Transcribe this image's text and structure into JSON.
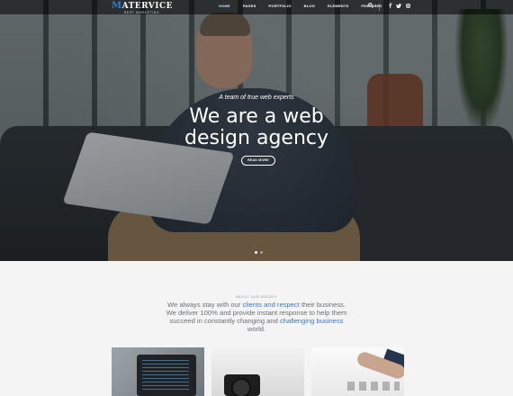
{
  "nav": {
    "logo_letter": "M",
    "logo_rest": "ATERVICE",
    "logo_sub": "BEST MARKETING",
    "items": [
      {
        "label": "HOME",
        "active": true
      },
      {
        "label": "PAGES"
      },
      {
        "label": "PORTFOLIO"
      },
      {
        "label": "BLOG"
      },
      {
        "label": "ELEMENTS"
      },
      {
        "label": "FEATURES"
      }
    ],
    "icons": [
      "search-icon",
      "facebook-icon",
      "twitter-icon",
      "instagram-icon"
    ]
  },
  "hero": {
    "subtitle": "A team of true web experts",
    "title_line1": "We are a web",
    "title_line2": "design agency",
    "button": "READ MORE",
    "slides": 2,
    "active_slide": 1
  },
  "about": {
    "label": "ABOUT OUR AGENCY",
    "text_1": "We always stay with our ",
    "hl_1": "clients and respect",
    "text_2": " their business. We deliver 100% and provide instant response to help them succeed in constantly changing and ",
    "hl_2": "challenging business",
    "text_3": " world."
  },
  "colors": {
    "accent": "#3c79b7",
    "logo_accent": "#2f7fd1"
  }
}
